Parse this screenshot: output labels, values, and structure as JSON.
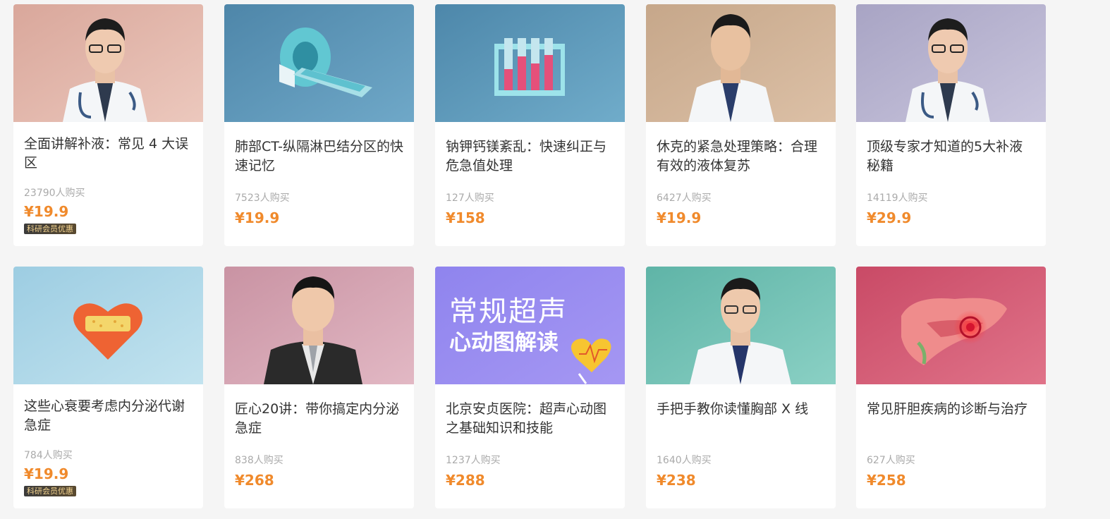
{
  "courses": [
    {
      "title": "全面讲解补液：常见 4 大误区",
      "sales": "23790人购买",
      "price": "¥19.9",
      "badge": "科研会员优惠"
    },
    {
      "title": "肺部CT-纵隔淋巴结分区的快速记忆",
      "sales": "7523人购买",
      "price": "¥19.9"
    },
    {
      "title": "钠钾钙镁紊乱：快速纠正与危急值处理",
      "sales": "127人购买",
      "price": "¥158"
    },
    {
      "title": "休克的紧急处理策略：合理有效的液体复苏",
      "sales": "6427人购买",
      "price": "¥19.9"
    },
    {
      "title": "顶级专家才知道的5大补液秘籍",
      "sales": "14119人购买",
      "price": "¥29.9"
    },
    {
      "title": "这些心衰要考虑内分泌代谢急症",
      "sales": "784人购买",
      "price": "¥19.9",
      "badge": "科研会员优惠"
    },
    {
      "title": "匠心20讲：带你搞定内分泌急症",
      "sales": "838人购买",
      "price": "¥268"
    },
    {
      "title": "北京安贞医院：超声心动图之基础知识和技能",
      "sales": "1237人购买",
      "price": "¥288",
      "cover_text_1": "常规超声",
      "cover_text_2": "心动图解读"
    },
    {
      "title": "手把手教你读懂胸部 X 线",
      "sales": "1640人购买",
      "price": "¥238"
    },
    {
      "title": "常见肝胆疾病的诊断与治疗",
      "sales": "627人购买",
      "price": "¥258"
    }
  ],
  "colors": {
    "price": "#f08a2c",
    "sales": "#aaaaaa",
    "title": "#333333",
    "background": "#f5f5f5"
  }
}
